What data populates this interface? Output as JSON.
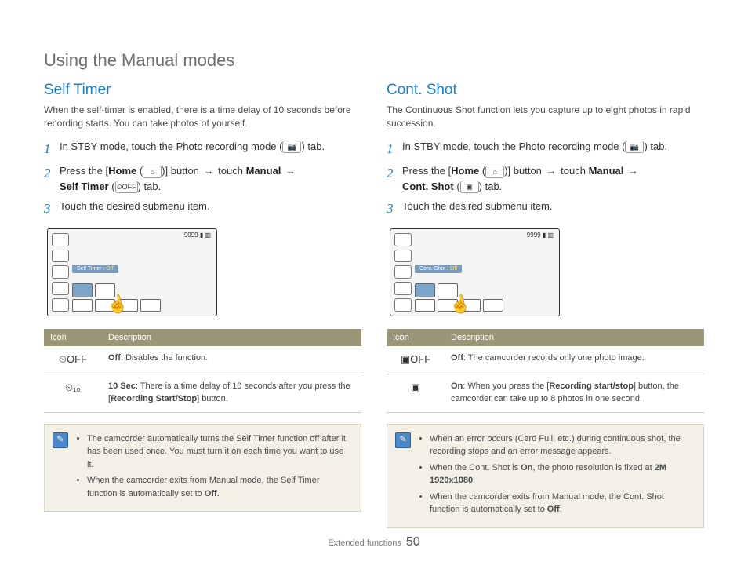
{
  "section_title": "Using the Manual modes",
  "footer": {
    "section": "Extended functions",
    "page": "50"
  },
  "glyphs": {
    "camera": "📷",
    "home": "⌂",
    "arrow": "→",
    "timer_off": "⏲OFF",
    "timer": "⏲",
    "contshot": "▣",
    "contoff": "▣OFF",
    "pencil": "✎"
  },
  "left": {
    "title": "Self Timer",
    "intro": "When the self-timer is enabled, there is a time delay of 10 seconds before recording starts. You can take photos of yourself.",
    "step1_a": "In STBY mode, touch the Photo recording mode (",
    "step1_b": ") tab.",
    "step2_a": "Press the [",
    "step2_home": "Home",
    "step2_b": " (",
    "step2_c": ")] button ",
    "step2_d": " touch ",
    "step2_manual": "Manual",
    "step2_e": " ",
    "step2_target": "Self Timer",
    "step2_f": " (",
    "step2_g": ") tab.",
    "step3": "Touch the desired submenu item.",
    "shot_caption": "Self Timer :",
    "shot_state": "Off",
    "shot_count": "9999",
    "table": {
      "h1": "Icon",
      "h2": "Description",
      "rows": [
        {
          "icon": "⏲OFF",
          "label": "Off",
          "text": ": Disables the function."
        },
        {
          "icon": "⏲₁₀",
          "label": "10 Sec",
          "text": ": There is a time delay of 10 seconds after you press the [",
          "bold2": "Recording Start/Stop",
          "text2": "] button."
        }
      ]
    },
    "notes": [
      {
        "text": "The camcorder automatically turns the Self Timer function off after it has been used once. You must turn it on each time you want to use it."
      },
      {
        "text_a": "When the camcorder exits from Manual mode, the Self Timer function is automatically set to ",
        "bold": "Off",
        "text_b": "."
      }
    ]
  },
  "right": {
    "title": "Cont. Shot",
    "intro": "The Continuous Shot function lets you capture up to eight photos in rapid succession.",
    "step1_a": "In STBY mode, touch the Photo recording mode (",
    "step1_b": ") tab.",
    "step2_a": "Press the [",
    "step2_home": "Home",
    "step2_b": " (",
    "step2_c": ")] button ",
    "step2_d": " touch ",
    "step2_manual": "Manual",
    "step2_e": " ",
    "step2_target": "Cont. Shot",
    "step2_f": " (",
    "step2_g": ") tab.",
    "step3": "Touch the desired submenu item.",
    "shot_caption": "Cont. Shot :",
    "shot_state": "Off",
    "shot_count": "9999",
    "table": {
      "h1": "Icon",
      "h2": "Description",
      "rows": [
        {
          "icon": "▣OFF",
          "label": "Off",
          "text": ": The camcorder records only one photo image."
        },
        {
          "icon": "▣",
          "label": "On",
          "text": ": When you press the [",
          "bold2": "Recording start/stop",
          "text2": "] button, the camcorder can take up to 8 photos in one second."
        }
      ]
    },
    "notes": [
      {
        "text": "When an error occurs (Card Full, etc.) during continuous shot, the recording stops and an error message appears."
      },
      {
        "text_a": "When the Cont. Shot is ",
        "bold": "On",
        "text_b": ", the photo resolution is fixed at ",
        "bold2": "2M 1920x1080",
        "text_c": "."
      },
      {
        "text_a": "When the camcorder exits from Manual mode, the Cont. Shot function is automatically set to ",
        "bold": "Off",
        "text_b": "."
      }
    ]
  }
}
